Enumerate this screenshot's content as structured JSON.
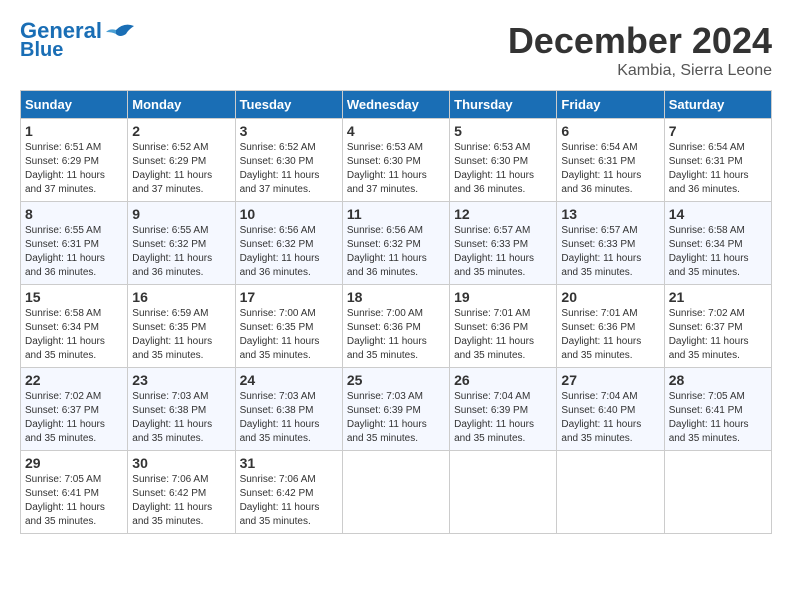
{
  "header": {
    "logo_line1": "General",
    "logo_line2": "Blue",
    "month": "December 2024",
    "location": "Kambia, Sierra Leone"
  },
  "weekdays": [
    "Sunday",
    "Monday",
    "Tuesday",
    "Wednesday",
    "Thursday",
    "Friday",
    "Saturday"
  ],
  "weeks": [
    [
      {
        "day": "1",
        "info": "Sunrise: 6:51 AM\nSunset: 6:29 PM\nDaylight: 11 hours\nand 37 minutes."
      },
      {
        "day": "2",
        "info": "Sunrise: 6:52 AM\nSunset: 6:29 PM\nDaylight: 11 hours\nand 37 minutes."
      },
      {
        "day": "3",
        "info": "Sunrise: 6:52 AM\nSunset: 6:30 PM\nDaylight: 11 hours\nand 37 minutes."
      },
      {
        "day": "4",
        "info": "Sunrise: 6:53 AM\nSunset: 6:30 PM\nDaylight: 11 hours\nand 37 minutes."
      },
      {
        "day": "5",
        "info": "Sunrise: 6:53 AM\nSunset: 6:30 PM\nDaylight: 11 hours\nand 36 minutes."
      },
      {
        "day": "6",
        "info": "Sunrise: 6:54 AM\nSunset: 6:31 PM\nDaylight: 11 hours\nand 36 minutes."
      },
      {
        "day": "7",
        "info": "Sunrise: 6:54 AM\nSunset: 6:31 PM\nDaylight: 11 hours\nand 36 minutes."
      }
    ],
    [
      {
        "day": "8",
        "info": "Sunrise: 6:55 AM\nSunset: 6:31 PM\nDaylight: 11 hours\nand 36 minutes."
      },
      {
        "day": "9",
        "info": "Sunrise: 6:55 AM\nSunset: 6:32 PM\nDaylight: 11 hours\nand 36 minutes."
      },
      {
        "day": "10",
        "info": "Sunrise: 6:56 AM\nSunset: 6:32 PM\nDaylight: 11 hours\nand 36 minutes."
      },
      {
        "day": "11",
        "info": "Sunrise: 6:56 AM\nSunset: 6:32 PM\nDaylight: 11 hours\nand 36 minutes."
      },
      {
        "day": "12",
        "info": "Sunrise: 6:57 AM\nSunset: 6:33 PM\nDaylight: 11 hours\nand 35 minutes."
      },
      {
        "day": "13",
        "info": "Sunrise: 6:57 AM\nSunset: 6:33 PM\nDaylight: 11 hours\nand 35 minutes."
      },
      {
        "day": "14",
        "info": "Sunrise: 6:58 AM\nSunset: 6:34 PM\nDaylight: 11 hours\nand 35 minutes."
      }
    ],
    [
      {
        "day": "15",
        "info": "Sunrise: 6:58 AM\nSunset: 6:34 PM\nDaylight: 11 hours\nand 35 minutes."
      },
      {
        "day": "16",
        "info": "Sunrise: 6:59 AM\nSunset: 6:35 PM\nDaylight: 11 hours\nand 35 minutes."
      },
      {
        "day": "17",
        "info": "Sunrise: 7:00 AM\nSunset: 6:35 PM\nDaylight: 11 hours\nand 35 minutes."
      },
      {
        "day": "18",
        "info": "Sunrise: 7:00 AM\nSunset: 6:36 PM\nDaylight: 11 hours\nand 35 minutes."
      },
      {
        "day": "19",
        "info": "Sunrise: 7:01 AM\nSunset: 6:36 PM\nDaylight: 11 hours\nand 35 minutes."
      },
      {
        "day": "20",
        "info": "Sunrise: 7:01 AM\nSunset: 6:36 PM\nDaylight: 11 hours\nand 35 minutes."
      },
      {
        "day": "21",
        "info": "Sunrise: 7:02 AM\nSunset: 6:37 PM\nDaylight: 11 hours\nand 35 minutes."
      }
    ],
    [
      {
        "day": "22",
        "info": "Sunrise: 7:02 AM\nSunset: 6:37 PM\nDaylight: 11 hours\nand 35 minutes."
      },
      {
        "day": "23",
        "info": "Sunrise: 7:03 AM\nSunset: 6:38 PM\nDaylight: 11 hours\nand 35 minutes."
      },
      {
        "day": "24",
        "info": "Sunrise: 7:03 AM\nSunset: 6:38 PM\nDaylight: 11 hours\nand 35 minutes."
      },
      {
        "day": "25",
        "info": "Sunrise: 7:03 AM\nSunset: 6:39 PM\nDaylight: 11 hours\nand 35 minutes."
      },
      {
        "day": "26",
        "info": "Sunrise: 7:04 AM\nSunset: 6:39 PM\nDaylight: 11 hours\nand 35 minutes."
      },
      {
        "day": "27",
        "info": "Sunrise: 7:04 AM\nSunset: 6:40 PM\nDaylight: 11 hours\nand 35 minutes."
      },
      {
        "day": "28",
        "info": "Sunrise: 7:05 AM\nSunset: 6:41 PM\nDaylight: 11 hours\nand 35 minutes."
      }
    ],
    [
      {
        "day": "29",
        "info": "Sunrise: 7:05 AM\nSunset: 6:41 PM\nDaylight: 11 hours\nand 35 minutes."
      },
      {
        "day": "30",
        "info": "Sunrise: 7:06 AM\nSunset: 6:42 PM\nDaylight: 11 hours\nand 35 minutes."
      },
      {
        "day": "31",
        "info": "Sunrise: 7:06 AM\nSunset: 6:42 PM\nDaylight: 11 hours\nand 35 minutes."
      },
      null,
      null,
      null,
      null
    ]
  ]
}
